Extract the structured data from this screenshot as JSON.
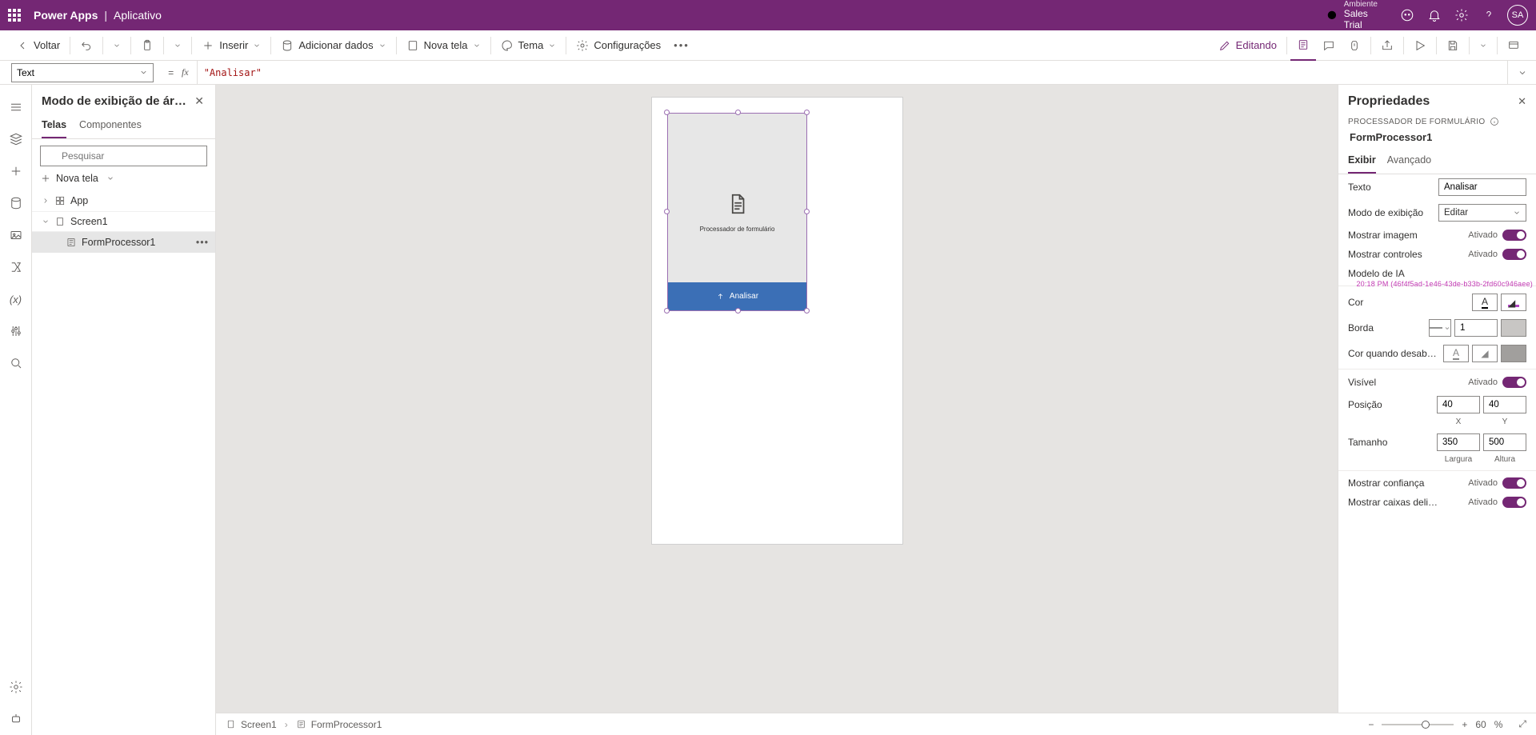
{
  "header": {
    "app": "Power Apps",
    "section": "Aplicativo",
    "env_label": "Ambiente",
    "env_name": "Sales Trial",
    "avatar": "SA"
  },
  "cmd": {
    "back": "Voltar",
    "insert": "Inserir",
    "add_data": "Adicionar dados",
    "new_screen": "Nova tela",
    "theme": "Tema",
    "settings": "Configurações",
    "editing": "Editando"
  },
  "fx": {
    "property": "Text",
    "value": "\"Analisar\""
  },
  "tree": {
    "title": "Modo de exibição de ár…",
    "tab_screens": "Telas",
    "tab_components": "Componentes",
    "search_placeholder": "Pesquisar",
    "new_screen": "Nova tela",
    "app": "App",
    "screen": "Screen1",
    "control": "FormProcessor1"
  },
  "canvas": {
    "control_caption": "Processador de formulário",
    "action_label": "Analisar"
  },
  "status": {
    "bc_screen": "Screen1",
    "bc_control": "FormProcessor1",
    "zoom": "60",
    "zoom_unit": "%"
  },
  "props": {
    "panel_title": "Propriedades",
    "type_label": "PROCESSADOR DE FORMULÁRIO",
    "component_name": "FormProcessor1",
    "tab_display": "Exibir",
    "tab_advanced": "Avançado",
    "text_label": "Texto",
    "text_value": "Analisar",
    "display_mode_label": "Modo de exibição",
    "display_mode_value": "Editar",
    "show_image_label": "Mostrar imagem",
    "show_controls_label": "Mostrar controles",
    "ai_model_label": "Modelo de IA",
    "color_label": "Cor",
    "border_label": "Borda",
    "border_width": "1",
    "disabled_color_label": "Cor quando desabili…",
    "visible_label": "Visível",
    "position_label": "Posição",
    "position_x": "40",
    "position_y": "40",
    "axis_x": "X",
    "axis_y": "Y",
    "size_label": "Tamanho",
    "size_w": "350",
    "size_h": "500",
    "axis_w": "Largura",
    "axis_h": "Altura",
    "show_confidence_label": "Mostrar confiança",
    "show_boxes_label": "Mostrar caixas deli…",
    "toggle_on": "Ativado",
    "overlay_text": "20:18 PM (46f4f5ad-1e46-43de-b33b-2fd60c946aee)"
  }
}
